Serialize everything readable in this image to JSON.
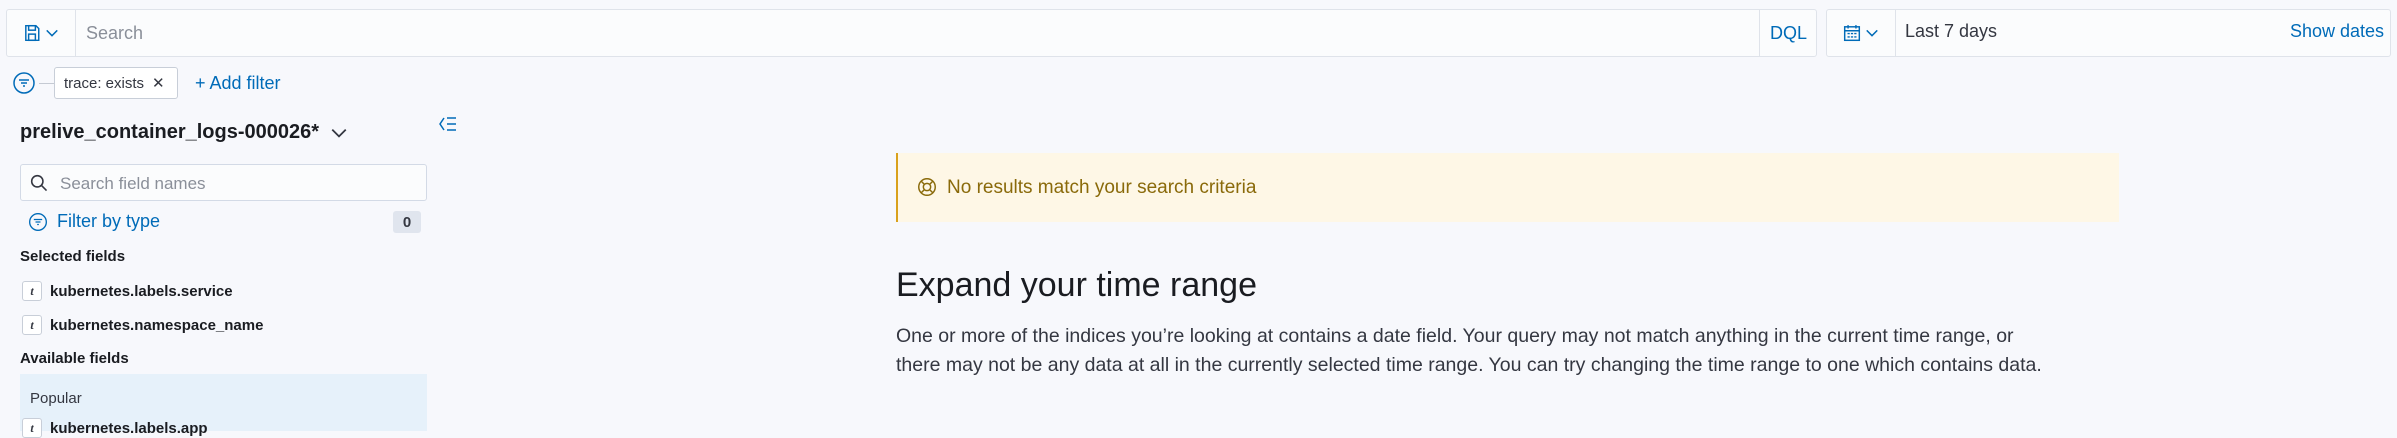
{
  "query": {
    "search_placeholder": "Search",
    "language_label": "DQL"
  },
  "date": {
    "range": "Last 7 days",
    "show_dates_label": "Show dates"
  },
  "filters": {
    "pill_label": "trace: exists",
    "add_filter_label": "+ Add filter"
  },
  "sidebar": {
    "index_pattern": "prelive_container_logs-000026*",
    "field_search_placeholder": "Search field names",
    "filter_by_type_label": "Filter by type",
    "filter_count": "0",
    "selected_title": "Selected fields",
    "selected_fields": [
      {
        "type": "t",
        "name": "kubernetes.labels.service"
      },
      {
        "type": "t",
        "name": "kubernetes.namespace_name"
      }
    ],
    "available_title": "Available fields",
    "popular_label": "Popular",
    "popular_fields": [
      {
        "type": "t",
        "name": "kubernetes.labels.app"
      }
    ]
  },
  "main": {
    "callout_text": "No results match your search criteria",
    "heading": "Expand your time range",
    "paragraph_line1": "One or more of the indices you’re looking at contains a date field. Your query may not match anything in the current time range, or",
    "paragraph_line2": "there may not be any data at all in the currently selected time range. You can try changing the time range to one which contains data."
  },
  "colors": {
    "accent": "#006bb8",
    "warning_bg": "#fef7e6",
    "warning_text": "#8a6a0a"
  }
}
